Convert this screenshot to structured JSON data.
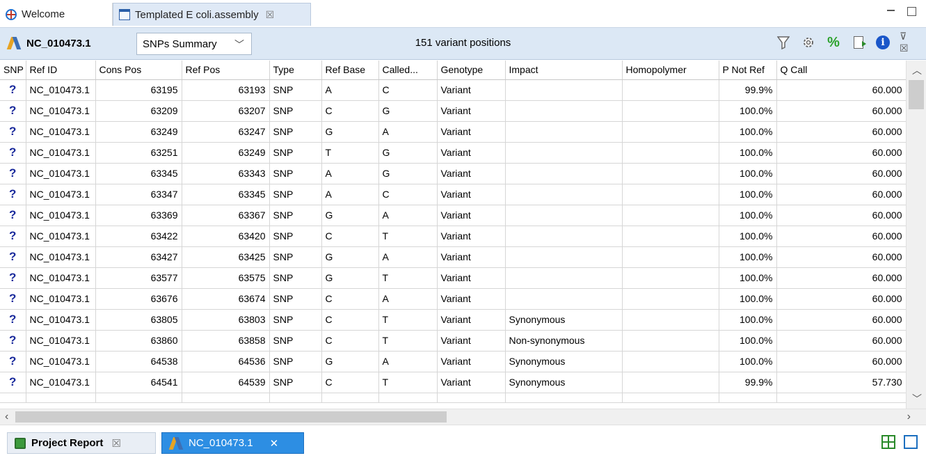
{
  "top_tabs": {
    "welcome_label": "Welcome",
    "document_label": "Templated E coli.assembly",
    "document_close": "☒"
  },
  "toolbar": {
    "contig_name": "NC_010473.1",
    "view_select": "SNPs Summary",
    "status": "151 variant positions",
    "icons": [
      "filter-icon",
      "settings-icon",
      "percent-icon",
      "export-icon",
      "info-icon",
      "view-menu-icon"
    ]
  },
  "table": {
    "columns": [
      "SNP",
      "Ref ID",
      "Cons Pos",
      "Ref Pos",
      "Type",
      "Ref Base",
      "Called...",
      "Genotype",
      "Impact",
      "Homopolymer",
      "P Not Ref",
      "Q Call"
    ],
    "rows": [
      [
        "?",
        "NC_010473.1",
        "63195",
        "63193",
        "SNP",
        "A",
        "C",
        "Variant",
        "",
        "",
        "99.9%",
        "60.000"
      ],
      [
        "?",
        "NC_010473.1",
        "63209",
        "63207",
        "SNP",
        "C",
        "G",
        "Variant",
        "",
        "",
        "100.0%",
        "60.000"
      ],
      [
        "?",
        "NC_010473.1",
        "63249",
        "63247",
        "SNP",
        "G",
        "A",
        "Variant",
        "",
        "",
        "100.0%",
        "60.000"
      ],
      [
        "?",
        "NC_010473.1",
        "63251",
        "63249",
        "SNP",
        "T",
        "G",
        "Variant",
        "",
        "",
        "100.0%",
        "60.000"
      ],
      [
        "?",
        "NC_010473.1",
        "63345",
        "63343",
        "SNP",
        "A",
        "G",
        "Variant",
        "",
        "",
        "100.0%",
        "60.000"
      ],
      [
        "?",
        "NC_010473.1",
        "63347",
        "63345",
        "SNP",
        "A",
        "C",
        "Variant",
        "",
        "",
        "100.0%",
        "60.000"
      ],
      [
        "?",
        "NC_010473.1",
        "63369",
        "63367",
        "SNP",
        "G",
        "A",
        "Variant",
        "",
        "",
        "100.0%",
        "60.000"
      ],
      [
        "?",
        "NC_010473.1",
        "63422",
        "63420",
        "SNP",
        "C",
        "T",
        "Variant",
        "",
        "",
        "100.0%",
        "60.000"
      ],
      [
        "?",
        "NC_010473.1",
        "63427",
        "63425",
        "SNP",
        "G",
        "A",
        "Variant",
        "",
        "",
        "100.0%",
        "60.000"
      ],
      [
        "?",
        "NC_010473.1",
        "63577",
        "63575",
        "SNP",
        "G",
        "T",
        "Variant",
        "",
        "",
        "100.0%",
        "60.000"
      ],
      [
        "?",
        "NC_010473.1",
        "63676",
        "63674",
        "SNP",
        "C",
        "A",
        "Variant",
        "",
        "",
        "100.0%",
        "60.000"
      ],
      [
        "?",
        "NC_010473.1",
        "63805",
        "63803",
        "SNP",
        "C",
        "T",
        "Variant",
        "Synonymous",
        "",
        "100.0%",
        "60.000"
      ],
      [
        "?",
        "NC_010473.1",
        "63860",
        "63858",
        "SNP",
        "C",
        "T",
        "Variant",
        "Non-synonymous",
        "",
        "100.0%",
        "60.000"
      ],
      [
        "?",
        "NC_010473.1",
        "64538",
        "64536",
        "SNP",
        "G",
        "A",
        "Variant",
        "Synonymous",
        "",
        "100.0%",
        "60.000"
      ],
      [
        "?",
        "NC_010473.1",
        "64541",
        "64539",
        "SNP",
        "C",
        "T",
        "Variant",
        "Synonymous",
        "",
        "99.9%",
        "57.730"
      ]
    ]
  },
  "bottom_tabs": {
    "report_label": "Project Report",
    "report_close": "☒",
    "contig_label": "NC_010473.1",
    "contig_close": "✕"
  },
  "colors": {
    "toolbar_bg": "#dce8f5",
    "active_bottom_tab": "#2d8ee3",
    "snp_question": "#1a2a9c"
  }
}
